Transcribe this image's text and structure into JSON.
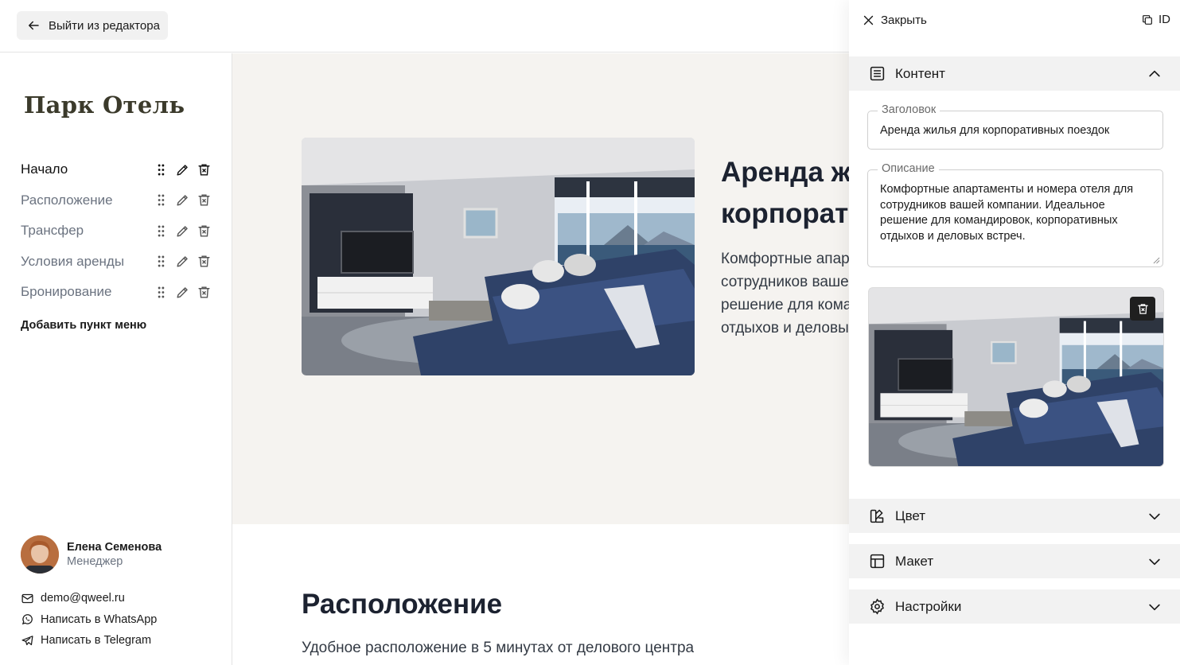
{
  "topbar": {
    "exit_label": "Выйти из редактора"
  },
  "sidebar": {
    "brand": "Парк Отель",
    "menu": [
      {
        "label": "Начало",
        "active": true
      },
      {
        "label": "Расположение",
        "active": false
      },
      {
        "label": "Трансфер",
        "active": false
      },
      {
        "label": "Условия аренды",
        "active": false
      },
      {
        "label": "Бронирование",
        "active": false
      }
    ],
    "add_menu_label": "Добавить пункт меню",
    "manager": {
      "name": "Елена Семенова",
      "role": "Менеджер"
    },
    "contacts": {
      "email": "demo@qweel.ru",
      "whatsapp": "Написать в WhatsApp",
      "telegram": "Написать в Telegram"
    }
  },
  "preview": {
    "hero_title": "Аренда жилья для корпоративных поездок",
    "hero_desc": "Комфортные апартаменты и номера отеля для сотрудников вашей компании. Идеальное решение для командировок, корпоративных отдыхов и деловых встреч.",
    "section_title": "Расположение",
    "section_desc": "Удобное расположение в 5 минутах от делового центра"
  },
  "panel": {
    "close_label": "Закрыть",
    "id_label": "ID",
    "sections": {
      "content": "Контент",
      "color": "Цвет",
      "layout": "Макет",
      "settings": "Настройки"
    },
    "fields": {
      "title_label": "Заголовок",
      "title_value": "Аренда жилья для корпоративных поездок",
      "desc_label": "Описание",
      "desc_value": "Комфортные апартаменты и номера отеля для сотрудников вашей компании. Идеальное решение для командировок, корпоративных отдыхов и деловых встреч."
    }
  },
  "colors": {
    "hero_bg": "#f5f3f0",
    "accordion_bg": "#f2f2f2",
    "muted_text": "#6b7380",
    "brand_text": "#3b3a2b"
  },
  "icons": [
    "arrow-left-icon",
    "drag-handle-icon",
    "pencil-icon",
    "trash-icon",
    "mail-icon",
    "whatsapp-icon",
    "telegram-icon",
    "close-icon",
    "copy-icon",
    "document-lines-icon",
    "palette-icon",
    "layout-grid-icon",
    "gear-icon",
    "chevron-up-icon",
    "chevron-down-icon"
  ]
}
